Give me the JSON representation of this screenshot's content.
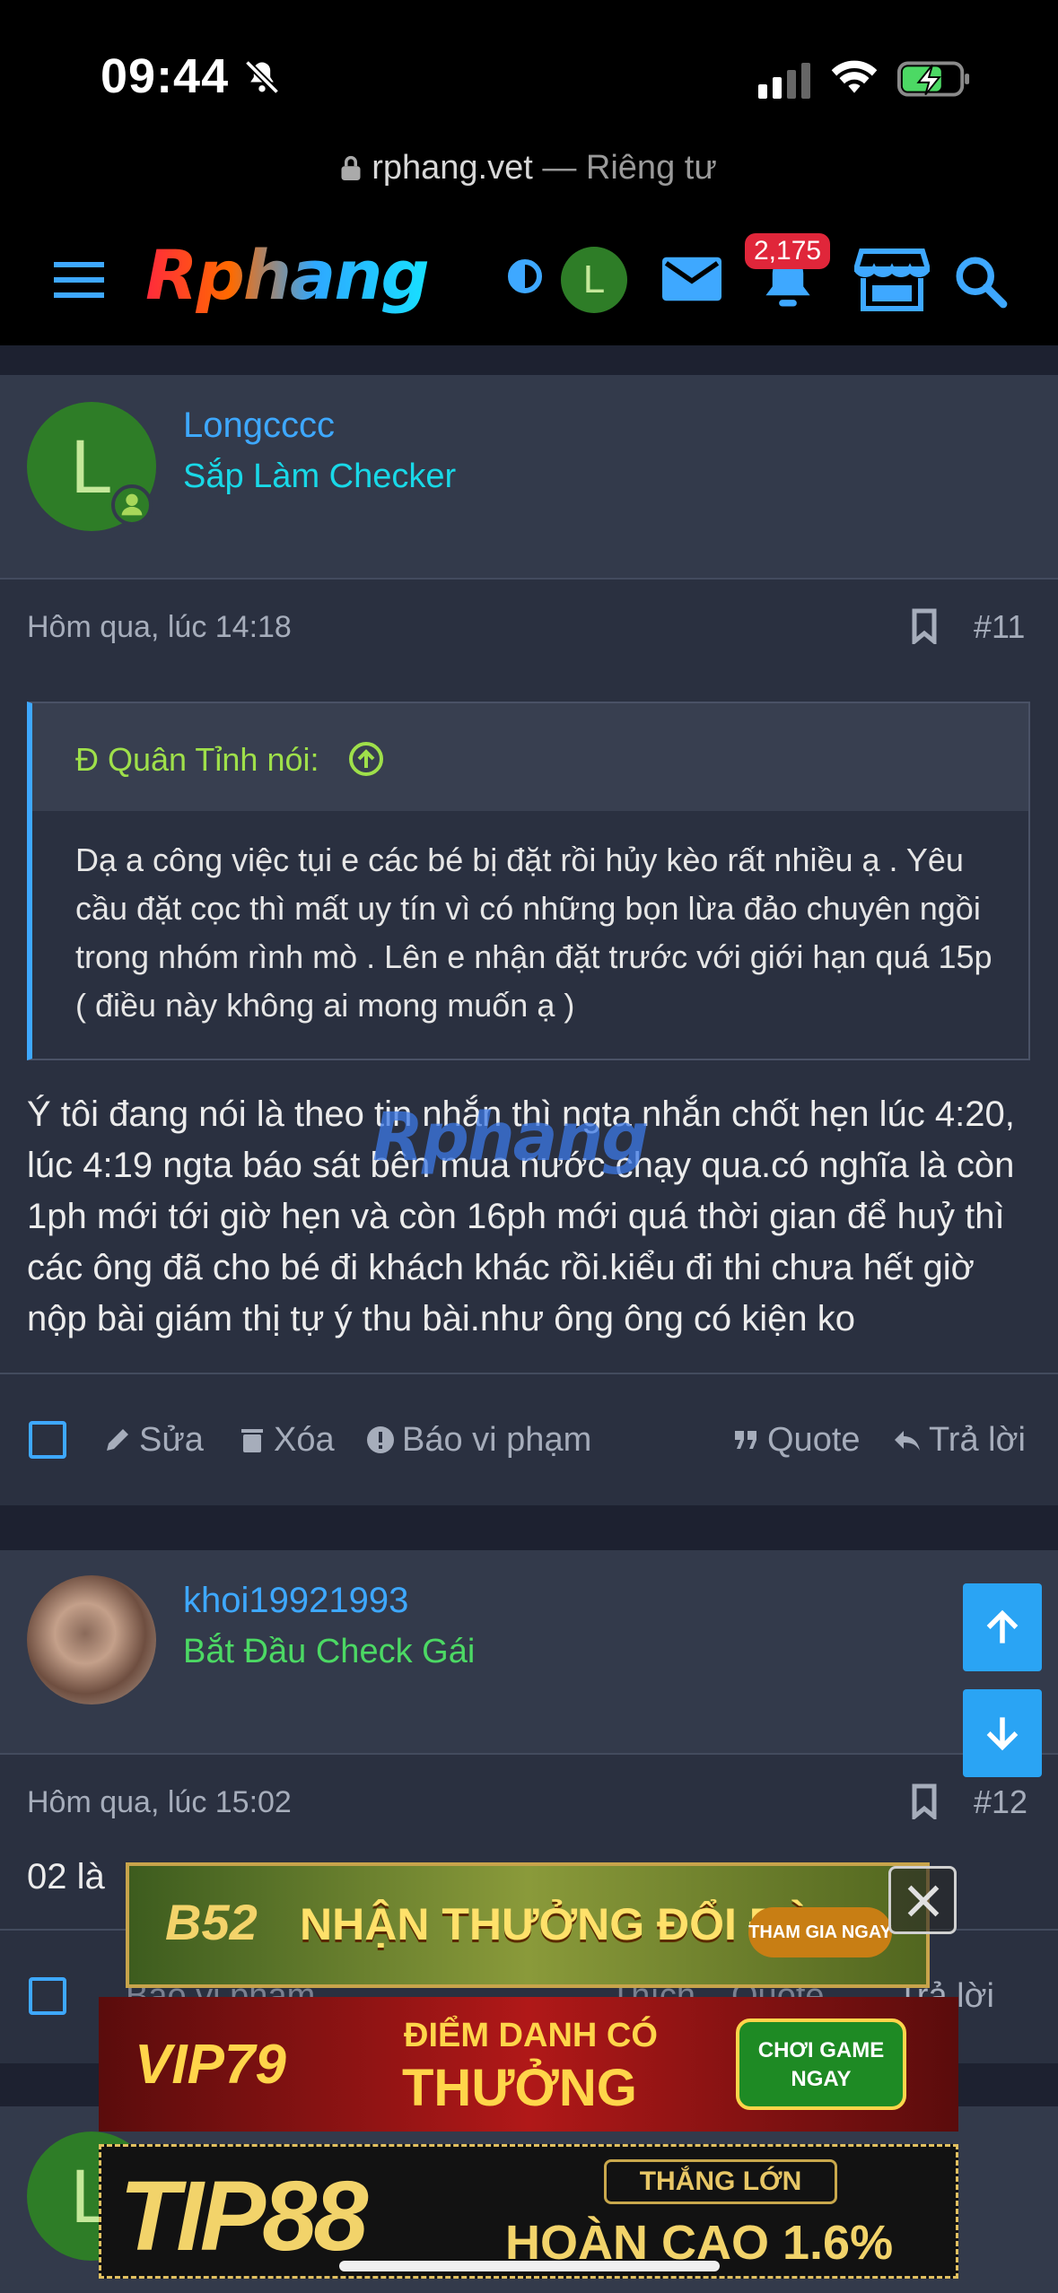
{
  "status_bar": {
    "time": "09:44"
  },
  "url_bar": {
    "domain": "rphang.vet",
    "suffix": "— Riêng tư"
  },
  "nav": {
    "logo": "Rphang",
    "avatar_letter": "L",
    "notification_count": "2,175"
  },
  "posts": [
    {
      "avatar_letter": "L",
      "username": "Longcccc",
      "user_title": "Sắp Làm Checker",
      "user_title_color": "#19d9e8",
      "timestamp": "Hôm qua, lúc 14:18",
      "post_number": "#11",
      "quote": {
        "author": "Đ Quân Tỉnh nói:",
        "text": "Dạ a công việc tụi e các bé bị đặt rồi hủy kèo rất nhiều ạ . Yêu cầu đặt cọc thì mất uy tín vì có những bọn lừa đảo chuyên ngồi trong nhóm rình mò . Lên e nhận đặt trước với giới hạn quá 15p ( điều này không ai mong muốn ạ )"
      },
      "body": "Ý tôi đang nói là theo tin nhắn thì ngta nhắn chốt hẹn lúc 4:20, lúc 4:19 ngta báo sát bên mua nước chạy qua.có nghĩa là còn 1ph mới tới giờ hẹn và còn 16ph mới quá thời gian để huỷ thì các ông đã cho bé đi khách khác rồi.kiểu đi thi chưa hết giờ nộp bài giám thị tự ý thu bài.như ông ông có kiện ko",
      "actions": {
        "edit": "Sửa",
        "delete": "Xóa",
        "report": "Báo vi phạm",
        "quote": "Quote",
        "reply": "Trả lời"
      }
    },
    {
      "username": "khoi19921993",
      "user_title": "Bắt Đầu Check Gái",
      "user_title_color": "#4cd964",
      "timestamp": "Hôm qua, lúc 15:02",
      "post_number": "#12",
      "body": "02 là",
      "actions": {
        "report": "Báo vi phạm",
        "like": "Thích",
        "quote": "Quote",
        "reply": "Trả lời"
      }
    }
  ],
  "watermark": "Rphang",
  "ads": {
    "ad1": {
      "brand": "B52",
      "text": "NHẬN THƯỞNG ĐỔI ĐỜI",
      "cta": "THAM GIA NGAY"
    },
    "ad2": {
      "brand": "VIP79",
      "line1": "ĐIỂM DANH CÓ",
      "line2": "THƯỞNG",
      "cta": "CHƠI GAME NGAY"
    },
    "ad3": {
      "brand": "TIP88",
      "badge": "THẮNG LỚN",
      "text": "HOÀN CAO 1.6%"
    }
  }
}
